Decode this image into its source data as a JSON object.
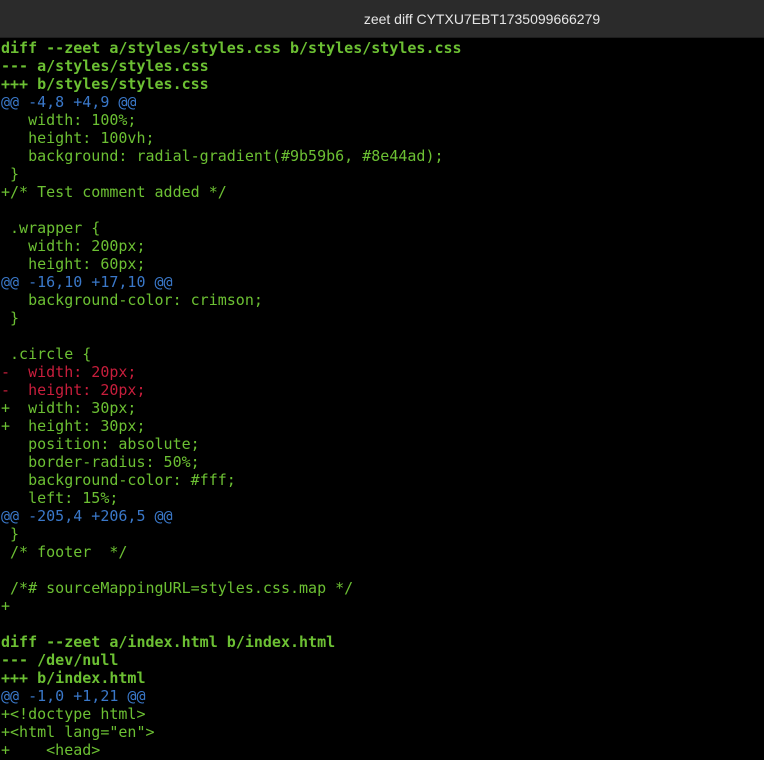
{
  "window": {
    "title": "zeet diff CYTXU7EBT1735099666279"
  },
  "colors": {
    "context": "#6cc033",
    "header": "#6cc033",
    "hunk": "#3a78c9",
    "added": "#6cc033",
    "removed": "#c81e3c",
    "background": "#000000"
  },
  "lines": [
    {
      "type": "hdr",
      "text": "diff --zeet a/styles/styles.css b/styles/styles.css"
    },
    {
      "type": "hdr",
      "text": "--- a/styles/styles.css"
    },
    {
      "type": "hdr",
      "text": "+++ b/styles/styles.css"
    },
    {
      "type": "hunk",
      "text": "@@ -4,8 +4,9 @@"
    },
    {
      "type": "ctx",
      "text": "   width: 100%;"
    },
    {
      "type": "ctx",
      "text": "   height: 100vh;"
    },
    {
      "type": "ctx",
      "text": "   background: radial-gradient(#9b59b6, #8e44ad);"
    },
    {
      "type": "ctx",
      "text": " }"
    },
    {
      "type": "add",
      "text": "+/* Test comment added */"
    },
    {
      "type": "ctx",
      "text": ""
    },
    {
      "type": "ctx",
      "text": " .wrapper {"
    },
    {
      "type": "ctx",
      "text": "   width: 200px;"
    },
    {
      "type": "ctx",
      "text": "   height: 60px;"
    },
    {
      "type": "hunk",
      "text": "@@ -16,10 +17,10 @@"
    },
    {
      "type": "ctx",
      "text": "   background-color: crimson;"
    },
    {
      "type": "ctx",
      "text": " }"
    },
    {
      "type": "ctx",
      "text": ""
    },
    {
      "type": "ctx",
      "text": " .circle {"
    },
    {
      "type": "del",
      "text": "-  width: 20px;"
    },
    {
      "type": "del",
      "text": "-  height: 20px;"
    },
    {
      "type": "add",
      "text": "+  width: 30px;"
    },
    {
      "type": "add",
      "text": "+  height: 30px;"
    },
    {
      "type": "ctx",
      "text": "   position: absolute;"
    },
    {
      "type": "ctx",
      "text": "   border-radius: 50%;"
    },
    {
      "type": "ctx",
      "text": "   background-color: #fff;"
    },
    {
      "type": "ctx",
      "text": "   left: 15%;"
    },
    {
      "type": "hunk",
      "text": "@@ -205,4 +206,5 @@"
    },
    {
      "type": "ctx",
      "text": " }"
    },
    {
      "type": "ctx",
      "text": " /* footer  */"
    },
    {
      "type": "ctx",
      "text": ""
    },
    {
      "type": "ctx",
      "text": " /*# sourceMappingURL=styles.css.map */"
    },
    {
      "type": "add",
      "text": "+"
    },
    {
      "type": "ctx",
      "text": ""
    },
    {
      "type": "hdr",
      "text": "diff --zeet a/index.html b/index.html"
    },
    {
      "type": "hdr",
      "text": "--- /dev/null"
    },
    {
      "type": "hdr",
      "text": "+++ b/index.html"
    },
    {
      "type": "hunk",
      "text": "@@ -1,0 +1,21 @@"
    },
    {
      "type": "add",
      "text": "+<!doctype html>"
    },
    {
      "type": "add",
      "text": "+<html lang=\"en\">"
    },
    {
      "type": "add",
      "text": "+    <head>"
    }
  ]
}
